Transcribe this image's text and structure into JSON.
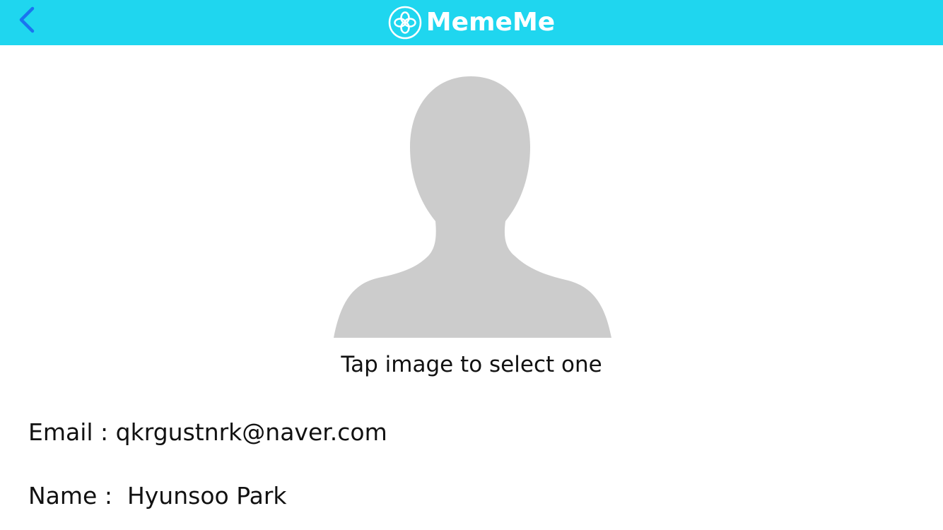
{
  "app": {
    "title": "MemeMe"
  },
  "navbar": {
    "background": "#1fd6ef",
    "back_icon": "chevron-left-icon",
    "back_color": "#1a74f0",
    "logo_icon": "clover-logo-icon"
  },
  "profile": {
    "avatar_icon": "person-silhouette-icon",
    "avatar_color": "#cccccc",
    "hint": "Tap image to select one"
  },
  "fields": {
    "email_label": "Email : ",
    "email_value": "qkrgustnrk@naver.com",
    "name_label": "Name :  ",
    "name_value": "Hyunsoo Park"
  }
}
